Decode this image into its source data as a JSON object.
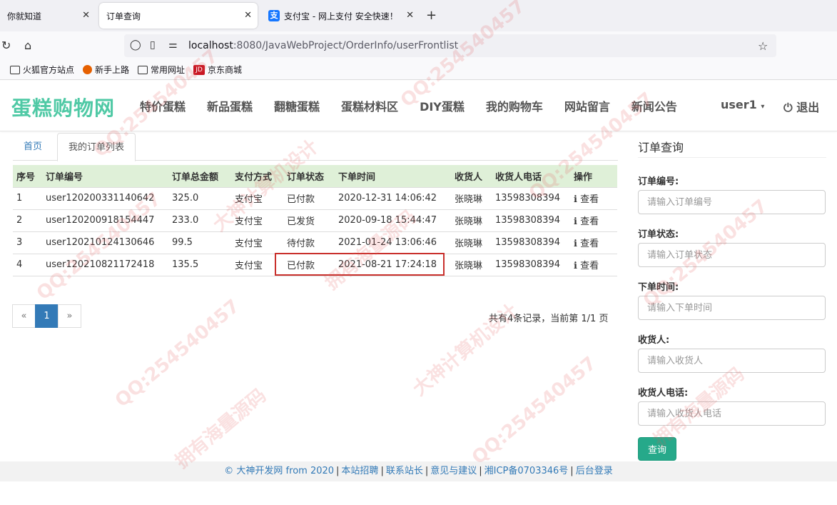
{
  "browser": {
    "tabs": [
      {
        "title": "你就知道"
      },
      {
        "title": "订单查询"
      },
      {
        "title": "支付宝 - 网上支付 安全快速！"
      }
    ],
    "url_host": "localhost",
    "url_rest": ":8080/JavaWebProject/OrderInfo/userFrontlist",
    "bookmarks": [
      "火狐官方站点",
      "新手上路",
      "常用网址",
      "京东商城"
    ]
  },
  "site": {
    "brand": "蛋糕购物网",
    "menu": [
      "特价蛋糕",
      "新品蛋糕",
      "翻糖蛋糕",
      "蛋糕材料区",
      "DIY蛋糕",
      "我的购物车",
      "网站留言",
      "新闻公告"
    ],
    "user": "user1",
    "logout": "退出"
  },
  "page_tabs": {
    "home": "首页",
    "current": "我的订单列表"
  },
  "table": {
    "headers": [
      "序号",
      "订单编号",
      "订单总金额",
      "支付方式",
      "订单状态",
      "下单时间",
      "收货人",
      "收货人电话",
      "操作"
    ],
    "rows": [
      [
        "1",
        "user120200331140642",
        "325.0",
        "支付宝",
        "已付款",
        "2020-12-31 14:06:42",
        "张晓琳",
        "13598308394",
        "查看"
      ],
      [
        "2",
        "user120200918154447",
        "233.0",
        "支付宝",
        "已发货",
        "2020-09-18 15:44:47",
        "张晓琳",
        "13598308394",
        "查看"
      ],
      [
        "3",
        "user120210124130646",
        "99.5",
        "支付宝",
        "待付款",
        "2021-01-24 13:06:46",
        "张晓琳",
        "13598308394",
        "查看"
      ],
      [
        "4",
        "user120210821172418",
        "135.5",
        "支付宝",
        "已付款",
        "2021-08-21 17:24:18",
        "张晓琳",
        "13598308394",
        "查看"
      ]
    ]
  },
  "pagination": {
    "prev": "«",
    "current": "1",
    "next": "»",
    "info": "共有4条记录，当前第 1/1 页"
  },
  "sidebar": {
    "title": "订单查询",
    "fields": [
      {
        "label": "订单编号:",
        "placeholder": "请输入订单编号"
      },
      {
        "label": "订单状态:",
        "placeholder": "请输入订单状态"
      },
      {
        "label": "下单时间:",
        "placeholder": "请输入下单时间"
      },
      {
        "label": "收货人:",
        "placeholder": "请输入收货人"
      },
      {
        "label": "收货人电话:",
        "placeholder": "请输入收货人电话"
      }
    ],
    "button": "查询"
  },
  "footer": {
    "links": [
      "© 大神开发网 from 2020",
      "本站招聘",
      "联系站长",
      "意见与建议",
      "湘ICP备0703346号",
      "后台登录"
    ]
  },
  "watermarks": [
    "QQ:254540457",
    "大神计算机设计",
    "拥有海量源码"
  ]
}
